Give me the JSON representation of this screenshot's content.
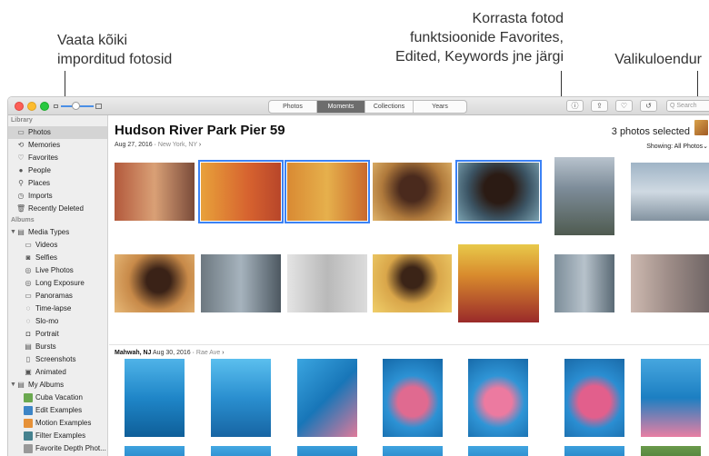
{
  "callouts": {
    "left_line1": "Vaata kõiki",
    "left_line2": "imporditud fotosid",
    "mid_line1": "Korrasta fotod",
    "mid_line2": "funktsioonide Favorites,",
    "mid_line3": "Edited, Keywords jne järgi",
    "right": "Valikuloendur"
  },
  "toolbar": {
    "tabs": [
      "Photos",
      "Moments",
      "Collections",
      "Years"
    ],
    "active_tab": "Moments",
    "search_placeholder": "Q Search"
  },
  "sidebar": {
    "library_header": "Library",
    "library": [
      {
        "label": "Photos",
        "icon": "photos-icon",
        "glyph": "▭",
        "selected": true
      },
      {
        "label": "Memories",
        "icon": "memories-icon",
        "glyph": "⟲"
      },
      {
        "label": "Favorites",
        "icon": "heart-icon",
        "glyph": "♡"
      },
      {
        "label": "People",
        "icon": "person-icon",
        "glyph": "●"
      },
      {
        "label": "Places",
        "icon": "pin-icon",
        "glyph": "⚲"
      },
      {
        "label": "Imports",
        "icon": "clock-icon",
        "glyph": "◷"
      },
      {
        "label": "Recently Deleted",
        "icon": "trash-icon",
        "glyph": "🗑"
      }
    ],
    "albums_header": "Albums",
    "media_types_label": "Media Types",
    "media_types": [
      {
        "label": "Videos",
        "icon": "video-icon",
        "glyph": "▭"
      },
      {
        "label": "Selfies",
        "icon": "selfie-icon",
        "glyph": "◙"
      },
      {
        "label": "Live Photos",
        "icon": "live-photo-icon",
        "glyph": "◎"
      },
      {
        "label": "Long Exposure",
        "icon": "long-exposure-icon",
        "glyph": "◎"
      },
      {
        "label": "Panoramas",
        "icon": "panorama-icon",
        "glyph": "▭"
      },
      {
        "label": "Time-lapse",
        "icon": "timelapse-icon",
        "glyph": "◌"
      },
      {
        "label": "Slo-mo",
        "icon": "slomo-icon",
        "glyph": "◌"
      },
      {
        "label": "Portrait",
        "icon": "portrait-icon",
        "glyph": "◘"
      },
      {
        "label": "Bursts",
        "icon": "bursts-icon",
        "glyph": "▤"
      },
      {
        "label": "Screenshots",
        "icon": "screenshot-icon",
        "glyph": "▯"
      },
      {
        "label": "Animated",
        "icon": "animated-icon",
        "glyph": "▣"
      }
    ],
    "my_albums_label": "My Albums",
    "my_albums": [
      {
        "label": "Cuba Vacation",
        "color": "#6aa84f"
      },
      {
        "label": "Edit Examples",
        "color": "#3d85c6"
      },
      {
        "label": "Motion Examples",
        "color": "#e69138"
      },
      {
        "label": "Filter Examples",
        "color": "#45818e"
      },
      {
        "label": "Favorite Depth Phot...",
        "color": "#999999"
      }
    ]
  },
  "moment": {
    "title": "Hudson River Park Pier 59",
    "date": "Aug 27, 2016",
    "location": "New York, NY",
    "selected_count": "3 photos selected",
    "showing": "Showing: All Photos"
  },
  "section2": {
    "title": "Mahwah, NJ",
    "date": "Aug 30, 2016",
    "location": "Rae Ave"
  },
  "colors": {
    "accent": "#3b82f6",
    "sidebar_bg": "#eeeeee",
    "selected_row": "#d4d4d4"
  },
  "photos_row1": [
    {
      "bg": "linear-gradient(90deg,#b3593c,#d9a076 50%,#7a4b3a)",
      "selected": false
    },
    {
      "bg": "linear-gradient(90deg,#e8a13a,#d6622f 60%,#b8462a)",
      "selected": true
    },
    {
      "bg": "linear-gradient(90deg,#d98a33,#e6b04c 50%,#c9692d)",
      "selected": true
    },
    {
      "bg": "radial-gradient(circle at 50% 45%,#4a2a1d 25%,#b07a3c 60%,#e0b46a)",
      "selected": false
    },
    {
      "bg": "radial-gradient(circle at 50% 45%,#2b1b14 28%,#3c5565 60%,#7aa1b0)",
      "selected": true
    },
    {
      "bg": "linear-gradient(180deg,#b8c3cd,#7d8c99 40%,#4f5b50)",
      "selected": false
    },
    {
      "bg": "linear-gradient(180deg,#9fb4c6,#cfd9e2 50%,#8393a0)",
      "selected": false
    }
  ],
  "photos_row2": [
    {
      "bg": "radial-gradient(circle at 55% 45%,#3a2217 22%,#c88a49 55%,#e7b978)"
    },
    {
      "bg": "linear-gradient(90deg,#6d7880,#a6b3bd 50%,#4d5861)"
    },
    {
      "bg": "linear-gradient(90deg,#e4e4e4,#b9b9b9 50%,#dcdcdc)"
    },
    {
      "bg": "radial-gradient(circle at 50% 40%,#3b2417 20%,#d9a64a 50%,#f0cf6a)"
    },
    {
      "bg": "linear-gradient(180deg,#e8c94a,#d88a2d 40%,#9a2a2a)"
    },
    {
      "bg": "linear-gradient(90deg,#7c8d99,#b7c2cb 50%,#5a6a75)"
    },
    {
      "bg": "linear-gradient(90deg,#cdb9b0,#9c8b86 50%,#6f6565)"
    }
  ],
  "photos_row3": [
    {
      "bg": "linear-gradient(180deg,#4fb3e8,#1f86c8 50%,#0f5f99)"
    },
    {
      "bg": "linear-gradient(180deg,#5bbfee,#2a8fd0 50%,#1765a3)"
    },
    {
      "bg": "linear-gradient(135deg,#3aa5e0,#1876b8 50%,#e07a9a)"
    },
    {
      "bg": "radial-gradient(circle at 50% 55%,#e06a90 28%,#2c92d4 50%,#1468a8)"
    },
    {
      "bg": "radial-gradient(circle at 50% 55%,#ec7aa0 26%,#2f95d6 50%,#176aa9)"
    },
    {
      "bg": "radial-gradient(circle at 50% 55%,#e25f8c 30%,#2a8ed2 52%,#1a6aa8)"
    },
    {
      "bg": "linear-gradient(180deg,#46a6df,#1c7fc2 50%,#e87fa3)"
    }
  ],
  "photos_row4": [
    {
      "bg": "linear-gradient(180deg,#3ea2de,#2280c4)"
    },
    {
      "bg": "linear-gradient(180deg,#44a8e2,#2584c8)"
    },
    {
      "bg": "linear-gradient(180deg,#3a9edb,#1f7cbf)"
    },
    {
      "bg": "linear-gradient(180deg,#3fa3df,#2381c5)"
    },
    {
      "bg": "linear-gradient(180deg,#41a5e0,#2483c6)"
    },
    {
      "bg": "linear-gradient(180deg,#3c9fdc,#207dc0)"
    },
    {
      "bg": "linear-gradient(180deg,#6a9a4a,#4a7a3a)"
    }
  ]
}
